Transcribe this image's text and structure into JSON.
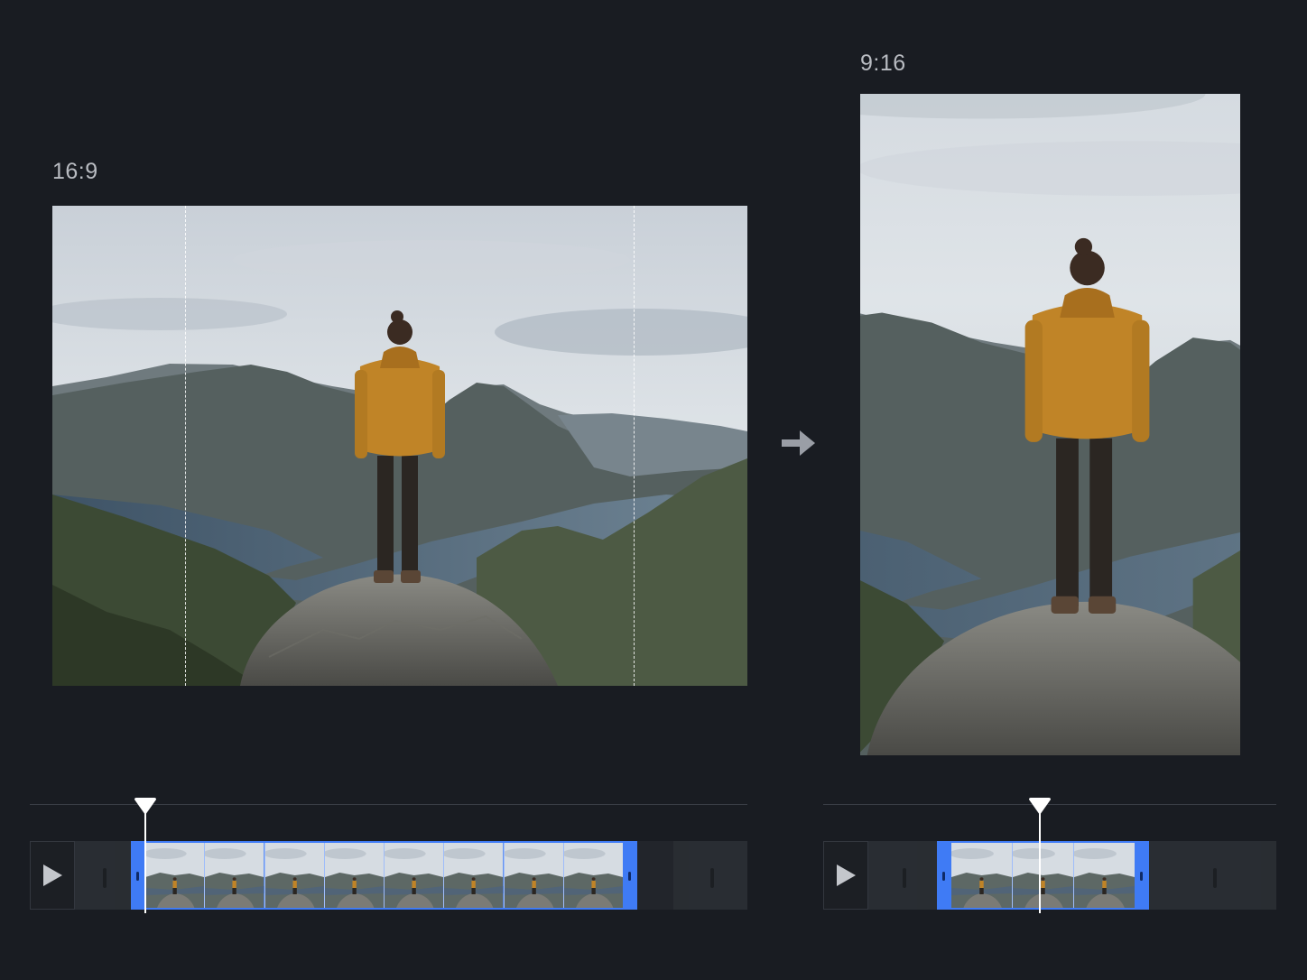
{
  "source": {
    "ratio_label": "16:9",
    "crop_guides_visible": true
  },
  "target": {
    "ratio_label": "9:16"
  },
  "arrow_icon": "arrow-right-icon",
  "play_icon": "play-icon",
  "accent_color": "#3f7bf5",
  "background_color": "#191c22",
  "timelines": {
    "source": {
      "visible_thumbnails": 8
    },
    "target": {
      "visible_thumbnails": 3
    }
  }
}
